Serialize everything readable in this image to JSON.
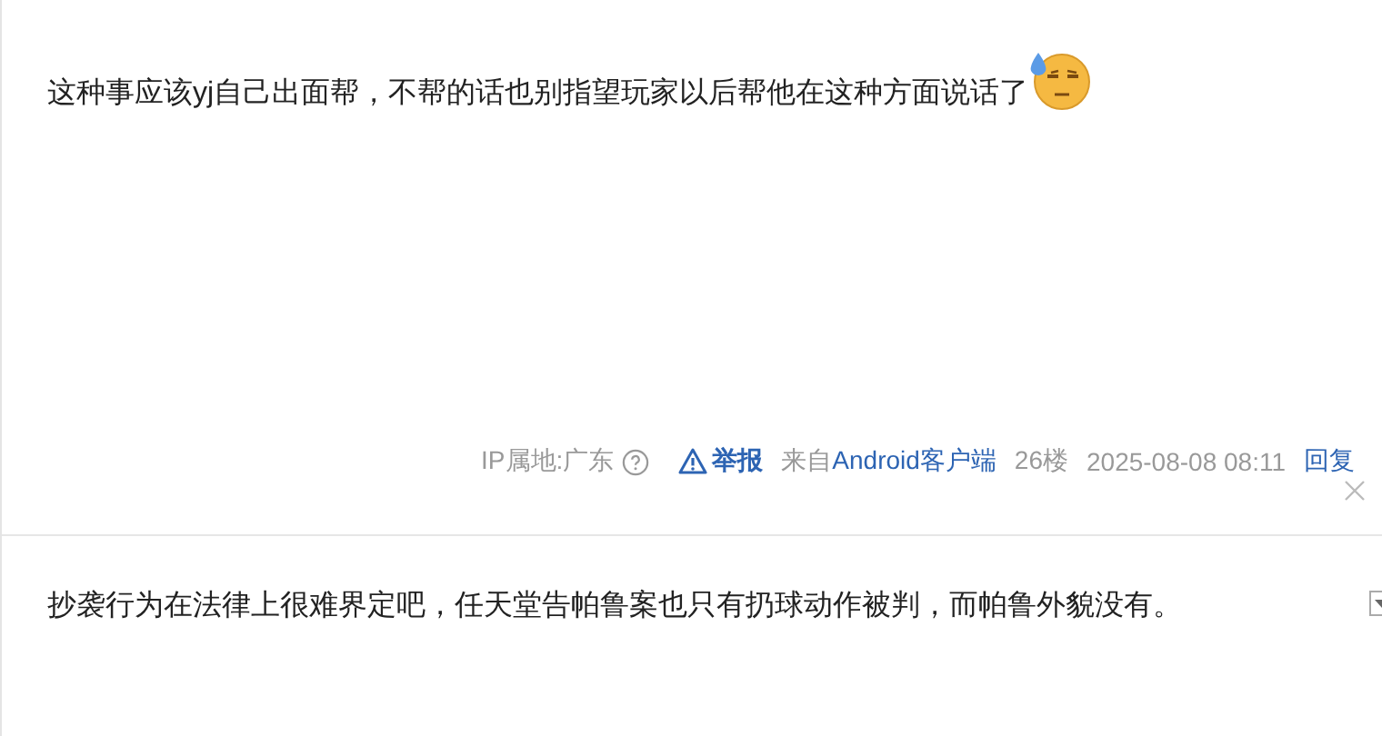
{
  "post": {
    "text": "这种事应该yj自己出面帮，不帮的话也别指望玩家以后帮他在这种方面说话了",
    "meta": {
      "ip_location": "IP属地:广东",
      "report": "举报",
      "source_prefix": "来自",
      "source_link": "Android客户端",
      "floor": "26楼",
      "time": "2025-08-08 08:11",
      "reply": "回复"
    }
  },
  "next_post": {
    "text": "抄袭行为在法律上很难界定吧，任天堂告帕鲁案也只有扔球动作被判，而帕鲁外貌没有。"
  }
}
